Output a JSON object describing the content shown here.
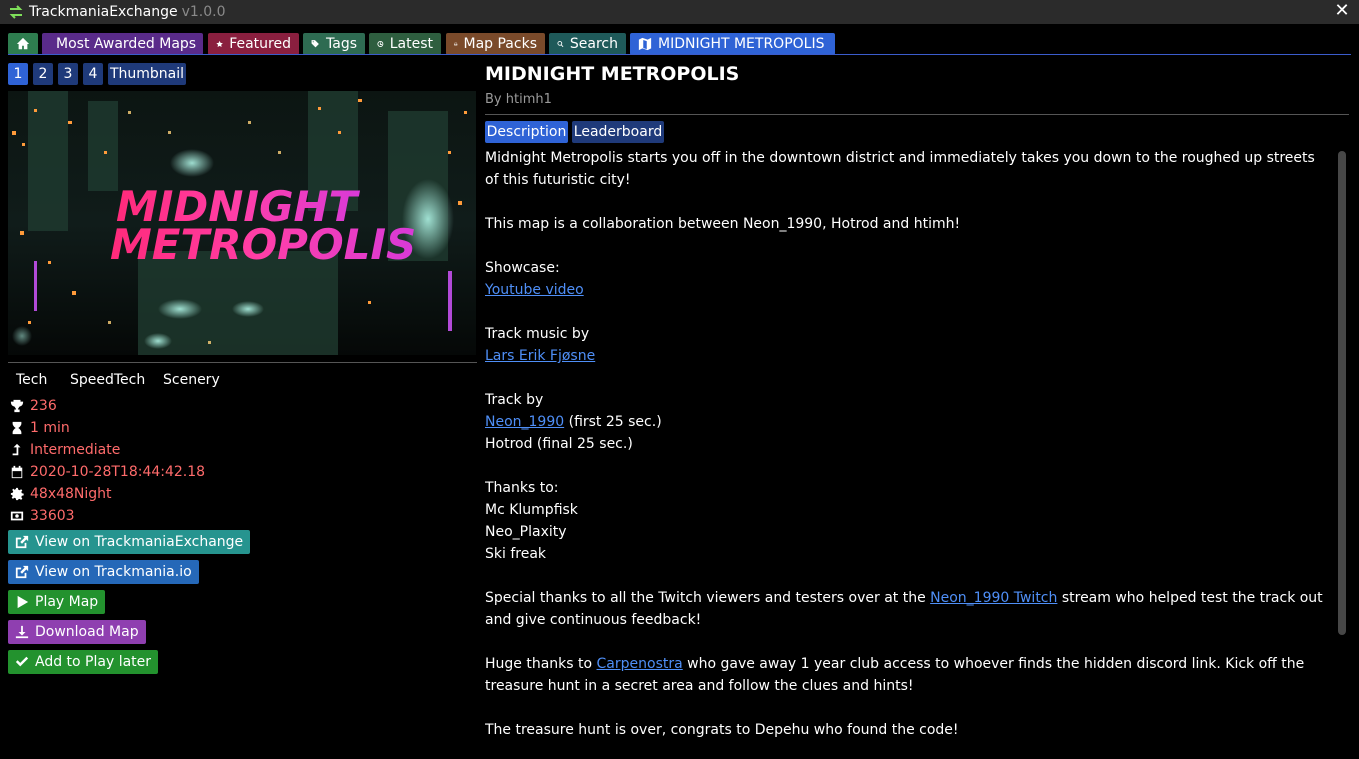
{
  "window": {
    "app_name": "TrackmaniaExchange",
    "version": "v1.0.0",
    "close_icon": "close-icon"
  },
  "tabs": [
    {
      "label": "",
      "icon": "home-icon",
      "color": "#2e7d4f"
    },
    {
      "label": "Most Awarded Maps",
      "icon": "trophy-icon",
      "color": "#5a2b8a"
    },
    {
      "label": "Featured",
      "icon": "star-icon",
      "color": "#8a1f3f"
    },
    {
      "label": "Tags",
      "icon": "tags-icon",
      "color": "#2e6b52"
    },
    {
      "label": "Latest",
      "icon": "clock-icon",
      "color": "#2e5e3f"
    },
    {
      "label": "Map Packs",
      "icon": "inbox-icon",
      "color": "#7a4a2a"
    },
    {
      "label": "Search",
      "icon": "search-icon",
      "color": "#1f5a5a"
    },
    {
      "label": "MIDNIGHT METROPOLIS",
      "icon": "map-icon",
      "color": "#2f63d6",
      "active": true
    }
  ],
  "image_tabs": [
    "1",
    "2",
    "3",
    "4",
    "Thumbnail"
  ],
  "image_tabs_active": "1",
  "thumbnail": {
    "line1": "MIDNIGHT",
    "line2": "METROPOLIS"
  },
  "map_tags": [
    "Tech",
    "SpeedTech",
    "Scenery"
  ],
  "stats": {
    "awards": "236",
    "length": "1 min",
    "difficulty": "Intermediate",
    "uploaded": "2020-10-28T18:44:42.18",
    "environment": "48x48Night",
    "track_id": "33603"
  },
  "actions": {
    "view_tmx": "View on TrackmaniaExchange",
    "view_tmio": "View on Trackmania.io",
    "play": "Play Map",
    "download": "Download Map",
    "play_later": "Add to Play later"
  },
  "action_colors": {
    "view_tmx": "#26948f",
    "view_tmio": "#2568b8",
    "play": "#23922e",
    "download": "#8f3fb0",
    "play_later": "#23922e"
  },
  "map": {
    "title": "MIDNIGHT METROPOLIS",
    "author": "By htimh1"
  },
  "detail_tabs": [
    "Description",
    "Leaderboard"
  ],
  "description": {
    "p1": "Midnight Metropolis starts you off in the downtown district and immediately takes you down to the roughed up streets of this futuristic city!",
    "p2": "This map is a collaboration between Neon_1990, Hotrod and htimh!",
    "showcase_label": "Showcase:",
    "showcase_link": "Youtube video",
    "music_label": "Track music by",
    "music_link": "Lars Erik Fjøsne",
    "track_label": "Track by",
    "track_link": "Neon_1990",
    "track_link_suffix": " (first 25 sec.)",
    "track_line2": "Hotrod (final 25 sec.)",
    "thanks_label": "Thanks to:",
    "thanks": [
      "Mc Klumpfisk",
      "Neo_Plaxity",
      "Ski freak"
    ],
    "special_prefix": "Special thanks to all the Twitch viewers and testers over at the ",
    "special_link": "Neon_1990 Twitch",
    "special_suffix": " stream who helped test the track out and give continuous feedback!",
    "huge_prefix": "Huge thanks to ",
    "huge_link": "Carpenostra",
    "huge_suffix": " who gave away 1 year club access to whoever finds the hidden discord link. Kick off the treasure hunt in a secret area and follow the clues and hints!",
    "final": "The treasure hunt is over, congrats to Depehu who found the code!"
  }
}
